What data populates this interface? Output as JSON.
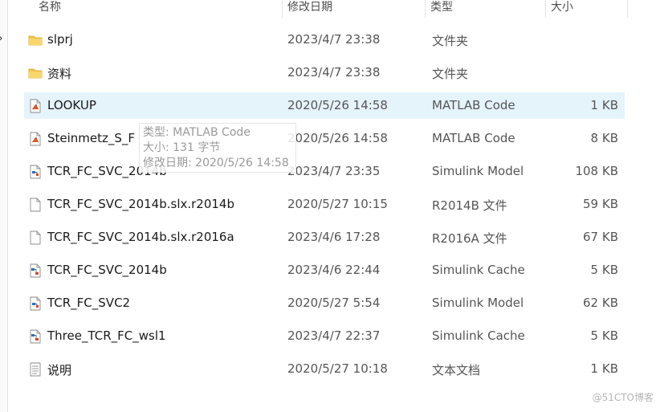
{
  "columns": {
    "name": "名称",
    "modified": "修改日期",
    "type": "类型",
    "size": "大小"
  },
  "files": [
    {
      "name": "slprj",
      "modified": "2023/4/7 23:38",
      "type": "文件夹",
      "size": "",
      "icon": "folder-icon"
    },
    {
      "name": "资料",
      "modified": "2023/4/7 23:38",
      "type": "文件夹",
      "size": "",
      "icon": "folder-icon"
    },
    {
      "name": "LOOKUP",
      "modified": "2020/5/26 14:58",
      "type": "MATLAB Code",
      "size": "1 KB",
      "icon": "matlab-file-icon",
      "selected": true
    },
    {
      "name": "Steinmetz_S_F",
      "modified": "2020/5/26 14:58",
      "type": "MATLAB Code",
      "size": "8 KB",
      "icon": "matlab-file-icon"
    },
    {
      "name": "TCR_FC_SVC_2014b",
      "modified": "2023/4/7 23:35",
      "type": "Simulink Model",
      "size": "108 KB",
      "icon": "simulink-model-icon"
    },
    {
      "name": "TCR_FC_SVC_2014b.slx.r2014b",
      "modified": "2020/5/27 10:15",
      "type": "R2014B 文件",
      "size": "59 KB",
      "icon": "blank-file-icon"
    },
    {
      "name": "TCR_FC_SVC_2014b.slx.r2016a",
      "modified": "2023/4/6 17:28",
      "type": "R2016A 文件",
      "size": "67 KB",
      "icon": "blank-file-icon"
    },
    {
      "name": "TCR_FC_SVC_2014b",
      "modified": "2023/4/6 22:44",
      "type": "Simulink Cache",
      "size": "5 KB",
      "icon": "simulink-cache-icon"
    },
    {
      "name": "TCR_FC_SVC2",
      "modified": "2020/5/27 5:54",
      "type": "Simulink Model",
      "size": "62 KB",
      "icon": "simulink-model-icon"
    },
    {
      "name": "Three_TCR_FC_wsl1",
      "modified": "2023/4/7 22:37",
      "type": "Simulink Cache",
      "size": "5 KB",
      "icon": "simulink-cache-icon"
    },
    {
      "name": "说明",
      "modified": "2020/5/27 10:18",
      "type": "文本文档",
      "size": "1 KB",
      "icon": "text-file-icon"
    }
  ],
  "tooltip": {
    "type_line": "类型: MATLAB Code",
    "size_line": "大小: 131 字节",
    "modified_line": "修改日期: 2020/5/26 14:58"
  },
  "watermark": "@51CTO博客",
  "left_nav_glyph": "›",
  "colors": {
    "selection": "#e5f3fb",
    "folder": "#f0c24e",
    "matlab": "#d9442b",
    "simulink": "#2f6fb2"
  }
}
